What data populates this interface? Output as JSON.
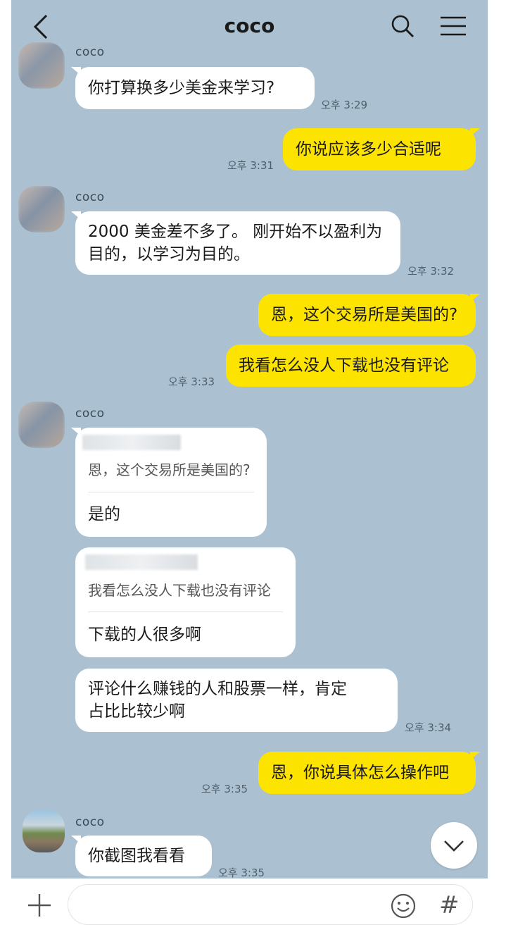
{
  "header": {
    "title": "coco",
    "back_icon": "chevron-left-icon",
    "search_icon": "search-icon",
    "menu_icon": "hamburger-menu-icon"
  },
  "messages": [
    {
      "sender": "coco",
      "text": "你打算换多少美金来学习?",
      "time": "오후 3:29"
    },
    {
      "sender": "me",
      "text": "你说应该多少合适呢",
      "time": "오후 3:31"
    },
    {
      "sender": "coco",
      "lines": [
        "2000 美金差不多了。 刚开始不以盈利为",
        "目的，以学习为目的。"
      ],
      "time": "오후 3:32"
    },
    {
      "sender": "me",
      "text": "恩，这个交易所是美国的?"
    },
    {
      "sender": "me",
      "text": "我看怎么没人下载也没有评论",
      "time": "오후 3:33"
    },
    {
      "sender": "coco",
      "quote": "恩，这个交易所是美国的?",
      "text": "是的"
    },
    {
      "sender": "coco",
      "quote": "我看怎么没人下载也没有评论",
      "text": "下载的人很多啊"
    },
    {
      "sender": "coco",
      "lines": [
        "评论什么赚钱的人和股票一样，肯定",
        "占比比较少啊"
      ],
      "time": "오후 3:34"
    },
    {
      "sender": "me",
      "text": "恩，你说具体怎么操作吧",
      "time": "오후 3:35"
    },
    {
      "sender": "coco",
      "text": "你截图我看看",
      "time": "오후 3:35"
    }
  ],
  "sender_names": [
    "coco",
    "coco",
    "coco",
    "coco",
    "coco"
  ],
  "input": {
    "placeholder": "",
    "plus_icon": "plus-icon",
    "emoji_icon": "emoji-icon",
    "hash_label": "#"
  },
  "colors": {
    "chat_bg": "#abc1d1",
    "out_bubble": "#fde300",
    "in_bubble": "#ffffff"
  }
}
